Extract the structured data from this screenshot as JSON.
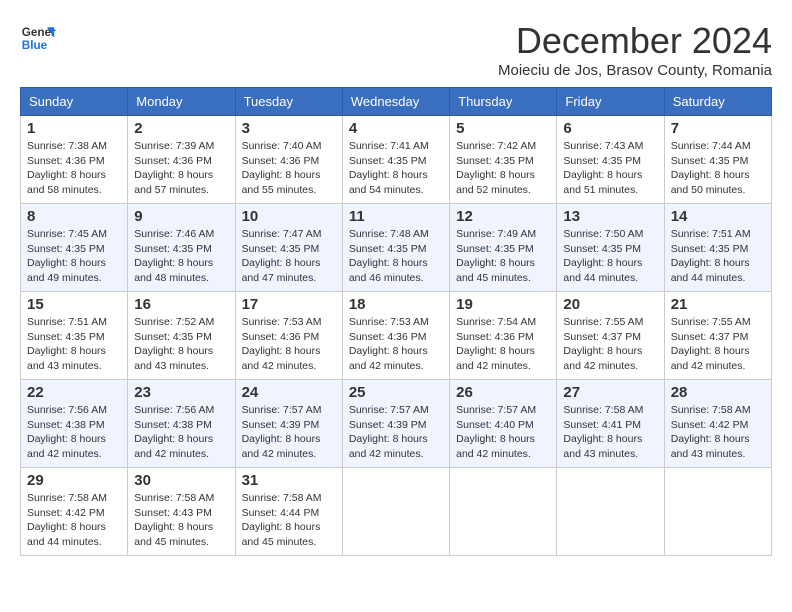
{
  "header": {
    "logo_line1": "General",
    "logo_line2": "Blue",
    "month_title": "December 2024",
    "subtitle": "Moieciu de Jos, Brasov County, Romania"
  },
  "columns": [
    "Sunday",
    "Monday",
    "Tuesday",
    "Wednesday",
    "Thursday",
    "Friday",
    "Saturday"
  ],
  "weeks": [
    [
      {
        "day": "1",
        "sunrise": "Sunrise: 7:38 AM",
        "sunset": "Sunset: 4:36 PM",
        "daylight": "Daylight: 8 hours and 58 minutes."
      },
      {
        "day": "2",
        "sunrise": "Sunrise: 7:39 AM",
        "sunset": "Sunset: 4:36 PM",
        "daylight": "Daylight: 8 hours and 57 minutes."
      },
      {
        "day": "3",
        "sunrise": "Sunrise: 7:40 AM",
        "sunset": "Sunset: 4:36 PM",
        "daylight": "Daylight: 8 hours and 55 minutes."
      },
      {
        "day": "4",
        "sunrise": "Sunrise: 7:41 AM",
        "sunset": "Sunset: 4:35 PM",
        "daylight": "Daylight: 8 hours and 54 minutes."
      },
      {
        "day": "5",
        "sunrise": "Sunrise: 7:42 AM",
        "sunset": "Sunset: 4:35 PM",
        "daylight": "Daylight: 8 hours and 52 minutes."
      },
      {
        "day": "6",
        "sunrise": "Sunrise: 7:43 AM",
        "sunset": "Sunset: 4:35 PM",
        "daylight": "Daylight: 8 hours and 51 minutes."
      },
      {
        "day": "7",
        "sunrise": "Sunrise: 7:44 AM",
        "sunset": "Sunset: 4:35 PM",
        "daylight": "Daylight: 8 hours and 50 minutes."
      }
    ],
    [
      {
        "day": "8",
        "sunrise": "Sunrise: 7:45 AM",
        "sunset": "Sunset: 4:35 PM",
        "daylight": "Daylight: 8 hours and 49 minutes."
      },
      {
        "day": "9",
        "sunrise": "Sunrise: 7:46 AM",
        "sunset": "Sunset: 4:35 PM",
        "daylight": "Daylight: 8 hours and 48 minutes."
      },
      {
        "day": "10",
        "sunrise": "Sunrise: 7:47 AM",
        "sunset": "Sunset: 4:35 PM",
        "daylight": "Daylight: 8 hours and 47 minutes."
      },
      {
        "day": "11",
        "sunrise": "Sunrise: 7:48 AM",
        "sunset": "Sunset: 4:35 PM",
        "daylight": "Daylight: 8 hours and 46 minutes."
      },
      {
        "day": "12",
        "sunrise": "Sunrise: 7:49 AM",
        "sunset": "Sunset: 4:35 PM",
        "daylight": "Daylight: 8 hours and 45 minutes."
      },
      {
        "day": "13",
        "sunrise": "Sunrise: 7:50 AM",
        "sunset": "Sunset: 4:35 PM",
        "daylight": "Daylight: 8 hours and 44 minutes."
      },
      {
        "day": "14",
        "sunrise": "Sunrise: 7:51 AM",
        "sunset": "Sunset: 4:35 PM",
        "daylight": "Daylight: 8 hours and 44 minutes."
      }
    ],
    [
      {
        "day": "15",
        "sunrise": "Sunrise: 7:51 AM",
        "sunset": "Sunset: 4:35 PM",
        "daylight": "Daylight: 8 hours and 43 minutes."
      },
      {
        "day": "16",
        "sunrise": "Sunrise: 7:52 AM",
        "sunset": "Sunset: 4:35 PM",
        "daylight": "Daylight: 8 hours and 43 minutes."
      },
      {
        "day": "17",
        "sunrise": "Sunrise: 7:53 AM",
        "sunset": "Sunset: 4:36 PM",
        "daylight": "Daylight: 8 hours and 42 minutes."
      },
      {
        "day": "18",
        "sunrise": "Sunrise: 7:53 AM",
        "sunset": "Sunset: 4:36 PM",
        "daylight": "Daylight: 8 hours and 42 minutes."
      },
      {
        "day": "19",
        "sunrise": "Sunrise: 7:54 AM",
        "sunset": "Sunset: 4:36 PM",
        "daylight": "Daylight: 8 hours and 42 minutes."
      },
      {
        "day": "20",
        "sunrise": "Sunrise: 7:55 AM",
        "sunset": "Sunset: 4:37 PM",
        "daylight": "Daylight: 8 hours and 42 minutes."
      },
      {
        "day": "21",
        "sunrise": "Sunrise: 7:55 AM",
        "sunset": "Sunset: 4:37 PM",
        "daylight": "Daylight: 8 hours and 42 minutes."
      }
    ],
    [
      {
        "day": "22",
        "sunrise": "Sunrise: 7:56 AM",
        "sunset": "Sunset: 4:38 PM",
        "daylight": "Daylight: 8 hours and 42 minutes."
      },
      {
        "day": "23",
        "sunrise": "Sunrise: 7:56 AM",
        "sunset": "Sunset: 4:38 PM",
        "daylight": "Daylight: 8 hours and 42 minutes."
      },
      {
        "day": "24",
        "sunrise": "Sunrise: 7:57 AM",
        "sunset": "Sunset: 4:39 PM",
        "daylight": "Daylight: 8 hours and 42 minutes."
      },
      {
        "day": "25",
        "sunrise": "Sunrise: 7:57 AM",
        "sunset": "Sunset: 4:39 PM",
        "daylight": "Daylight: 8 hours and 42 minutes."
      },
      {
        "day": "26",
        "sunrise": "Sunrise: 7:57 AM",
        "sunset": "Sunset: 4:40 PM",
        "daylight": "Daylight: 8 hours and 42 minutes."
      },
      {
        "day": "27",
        "sunrise": "Sunrise: 7:58 AM",
        "sunset": "Sunset: 4:41 PM",
        "daylight": "Daylight: 8 hours and 43 minutes."
      },
      {
        "day": "28",
        "sunrise": "Sunrise: 7:58 AM",
        "sunset": "Sunset: 4:42 PM",
        "daylight": "Daylight: 8 hours and 43 minutes."
      }
    ],
    [
      {
        "day": "29",
        "sunrise": "Sunrise: 7:58 AM",
        "sunset": "Sunset: 4:42 PM",
        "daylight": "Daylight: 8 hours and 44 minutes."
      },
      {
        "day": "30",
        "sunrise": "Sunrise: 7:58 AM",
        "sunset": "Sunset: 4:43 PM",
        "daylight": "Daylight: 8 hours and 45 minutes."
      },
      {
        "day": "31",
        "sunrise": "Sunrise: 7:58 AM",
        "sunset": "Sunset: 4:44 PM",
        "daylight": "Daylight: 8 hours and 45 minutes."
      },
      null,
      null,
      null,
      null
    ]
  ]
}
